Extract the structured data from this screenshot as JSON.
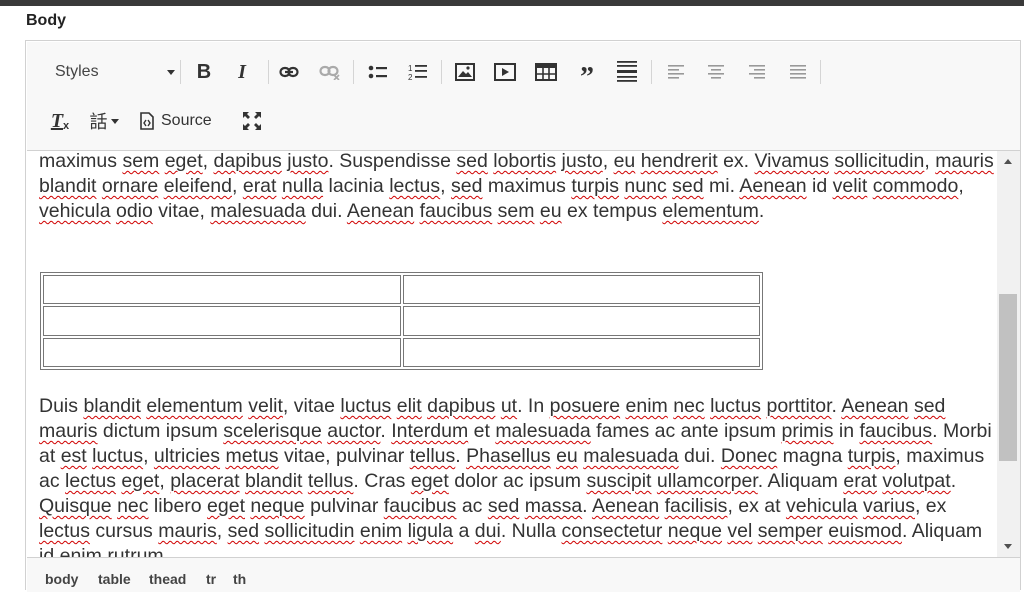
{
  "field": {
    "label": "Body"
  },
  "toolbar": {
    "styles_label": "Styles",
    "bold": "B",
    "italic": "I",
    "remove_format": "T",
    "language": "話",
    "source_label": "Source"
  },
  "content": {
    "para1": [
      {
        "t": "maximus "
      },
      {
        "t": "sem",
        "s": 1
      },
      {
        "t": " "
      },
      {
        "t": "eget",
        "s": 1
      },
      {
        "t": ", "
      },
      {
        "t": "dapibus",
        "s": 1
      },
      {
        "t": " "
      },
      {
        "t": "justo",
        "s": 1
      },
      {
        "t": ". Suspendisse "
      },
      {
        "t": "sed",
        "s": 1
      },
      {
        "t": " "
      },
      {
        "t": "lobortis",
        "s": 1
      },
      {
        "t": " "
      },
      {
        "t": "justo",
        "s": 1
      },
      {
        "t": ", "
      },
      {
        "t": "eu",
        "s": 1
      },
      {
        "t": " "
      },
      {
        "t": "hendrerit",
        "s": 1
      },
      {
        "t": " ex. "
      },
      {
        "t": "Vivamus",
        "s": 1
      },
      {
        "t": " "
      },
      {
        "t": "sollicitudin",
        "s": 1
      },
      {
        "t": ", "
      },
      {
        "t": "mauris",
        "s": 1
      },
      {
        "t": " "
      },
      {
        "t": "blandit",
        "s": 1
      },
      {
        "t": " "
      },
      {
        "t": "ornare",
        "s": 1
      },
      {
        "t": " "
      },
      {
        "t": "eleifend",
        "s": 1
      },
      {
        "t": ", "
      },
      {
        "t": "erat",
        "s": 1
      },
      {
        "t": " "
      },
      {
        "t": "nulla",
        "s": 1
      },
      {
        "t": " lacinia "
      },
      {
        "t": "lectus",
        "s": 1
      },
      {
        "t": ", "
      },
      {
        "t": "sed",
        "s": 1
      },
      {
        "t": " maximus "
      },
      {
        "t": "turpis",
        "s": 1
      },
      {
        "t": " "
      },
      {
        "t": "nunc",
        "s": 1
      },
      {
        "t": " "
      },
      {
        "t": "sed",
        "s": 1
      },
      {
        "t": " "
      },
      {
        "t": "mi. "
      },
      {
        "t": "Aenean",
        "s": 1
      },
      {
        "t": " id "
      },
      {
        "t": "velit",
        "s": 1
      },
      {
        "t": " "
      },
      {
        "t": "commodo",
        "s": 1
      },
      {
        "t": ", "
      },
      {
        "t": "vehicula",
        "s": 1
      },
      {
        "t": " "
      },
      {
        "t": "odio",
        "s": 1
      },
      {
        "t": " vitae, "
      },
      {
        "t": "malesuada",
        "s": 1
      },
      {
        "t": " dui. "
      },
      {
        "t": "Aenean",
        "s": 1
      },
      {
        "t": " "
      },
      {
        "t": "faucibus",
        "s": 1
      },
      {
        "t": " "
      },
      {
        "t": "sem",
        "s": 1
      },
      {
        "t": " "
      },
      {
        "t": "eu",
        "s": 1
      },
      {
        "t": " ex "
      },
      {
        "t": "tempus "
      },
      {
        "t": "elementum",
        "s": 1
      },
      {
        "t": "."
      }
    ],
    "table": {
      "rows": 3,
      "cols": 2
    },
    "para2": [
      {
        "t": "Duis "
      },
      {
        "t": "blandit",
        "s": 1
      },
      {
        "t": " "
      },
      {
        "t": "elementum",
        "s": 1
      },
      {
        "t": " "
      },
      {
        "t": "velit",
        "s": 1
      },
      {
        "t": ", vitae "
      },
      {
        "t": "luctus",
        "s": 1
      },
      {
        "t": " "
      },
      {
        "t": "elit",
        "s": 1
      },
      {
        "t": " "
      },
      {
        "t": "dapibus",
        "s": 1
      },
      {
        "t": " "
      },
      {
        "t": "ut",
        "s": 1
      },
      {
        "t": ". In "
      },
      {
        "t": "posuere",
        "s": 1
      },
      {
        "t": " "
      },
      {
        "t": "enim",
        "s": 1
      },
      {
        "t": " "
      },
      {
        "t": "nec",
        "s": 1
      },
      {
        "t": " "
      },
      {
        "t": "luctus",
        "s": 1
      },
      {
        "t": " "
      },
      {
        "t": "porttitor",
        "s": 1
      },
      {
        "t": ". "
      },
      {
        "t": "Aenean",
        "s": 1
      },
      {
        "t": " "
      },
      {
        "t": "sed",
        "s": 1
      },
      {
        "t": " "
      },
      {
        "t": "mauris",
        "s": 1
      },
      {
        "t": " dictum ipsum "
      },
      {
        "t": "scelerisque",
        "s": 1
      },
      {
        "t": " "
      },
      {
        "t": "auctor",
        "s": 1
      },
      {
        "t": ". "
      },
      {
        "t": "Interdum",
        "s": 1
      },
      {
        "t": " et "
      },
      {
        "t": "malesuada",
        "s": 1
      },
      {
        "t": " fames ac ante ipsum "
      },
      {
        "t": "primis",
        "s": 1
      },
      {
        "t": " in "
      },
      {
        "t": "faucibus",
        "s": 1
      },
      {
        "t": ". Morbi at "
      },
      {
        "t": "est",
        "s": 1
      },
      {
        "t": " "
      },
      {
        "t": "luctus",
        "s": 1
      },
      {
        "t": ", "
      },
      {
        "t": "ultricies",
        "s": 1
      },
      {
        "t": " "
      },
      {
        "t": "metus",
        "s": 1
      },
      {
        "t": " vitae, pulvinar "
      },
      {
        "t": "tellus",
        "s": 1
      },
      {
        "t": ". "
      },
      {
        "t": "Phasellus",
        "s": 1
      },
      {
        "t": " "
      },
      {
        "t": "eu",
        "s": 1
      },
      {
        "t": " "
      },
      {
        "t": "malesuada",
        "s": 1
      },
      {
        "t": " dui. "
      },
      {
        "t": "Donec",
        "s": 1
      },
      {
        "t": " magna "
      },
      {
        "t": "turpis",
        "s": 1
      },
      {
        "t": ", maximus ac "
      },
      {
        "t": "lectus",
        "s": 1
      },
      {
        "t": " "
      },
      {
        "t": "eget",
        "s": 1
      },
      {
        "t": ", "
      },
      {
        "t": "placerat",
        "s": 1
      },
      {
        "t": " "
      },
      {
        "t": "blandit",
        "s": 1
      },
      {
        "t": " "
      },
      {
        "t": "tellus",
        "s": 1
      },
      {
        "t": ". Cras "
      },
      {
        "t": "eget",
        "s": 1
      },
      {
        "t": " "
      },
      {
        "t": "dolor ac ipsum "
      },
      {
        "t": "suscipit",
        "s": 1
      },
      {
        "t": " "
      },
      {
        "t": "ullamcorper",
        "s": 1
      },
      {
        "t": ". Aliquam "
      },
      {
        "t": "erat",
        "s": 1
      },
      {
        "t": " "
      },
      {
        "t": "volutpat",
        "s": 1
      },
      {
        "t": ". "
      },
      {
        "t": "Quisque",
        "s": 1
      },
      {
        "t": " "
      },
      {
        "t": "nec",
        "s": 1
      },
      {
        "t": " libero "
      },
      {
        "t": "eget",
        "s": 1
      },
      {
        "t": " "
      },
      {
        "t": "neque",
        "s": 1
      },
      {
        "t": " pulvinar "
      },
      {
        "t": "faucibus",
        "s": 1
      },
      {
        "t": " ac "
      },
      {
        "t": "sed",
        "s": 1
      },
      {
        "t": " "
      },
      {
        "t": "massa",
        "s": 1
      },
      {
        "t": ". "
      },
      {
        "t": "Aenean",
        "s": 1
      },
      {
        "t": " "
      },
      {
        "t": "facilisis",
        "s": 1
      },
      {
        "t": ", ex at "
      },
      {
        "t": "vehicula",
        "s": 1
      },
      {
        "t": " "
      },
      {
        "t": "varius",
        "s": 1
      },
      {
        "t": ", ex "
      },
      {
        "t": "lectus",
        "s": 1
      },
      {
        "t": " cursus "
      },
      {
        "t": "mauris",
        "s": 1
      },
      {
        "t": ", "
      },
      {
        "t": "sed",
        "s": 1
      },
      {
        "t": " "
      },
      {
        "t": "sollicitudin",
        "s": 1
      },
      {
        "t": " "
      },
      {
        "t": "enim",
        "s": 1
      },
      {
        "t": " "
      },
      {
        "t": "ligula",
        "s": 1
      },
      {
        "t": " a "
      },
      {
        "t": "dui",
        "s": 1
      },
      {
        "t": ". Nulla "
      },
      {
        "t": "consectetur",
        "s": 1
      },
      {
        "t": " "
      },
      {
        "t": "neque",
        "s": 1
      },
      {
        "t": " "
      },
      {
        "t": "vel",
        "s": 1
      },
      {
        "t": " "
      },
      {
        "t": "semper",
        "s": 1
      },
      {
        "t": " "
      },
      {
        "t": "euismod",
        "s": 1
      },
      {
        "t": ". Aliquam id "
      },
      {
        "t": "enim",
        "s": 1
      },
      {
        "t": " "
      },
      {
        "t": "rutrum",
        "s": 1
      }
    ]
  },
  "path": [
    "body",
    "table",
    "thead",
    "tr",
    "th"
  ],
  "colors": {
    "spellcheck": "#d00000",
    "toolbar_bg": "#f8f8f8",
    "border": "#d1d1d1"
  },
  "icons": [
    "bold-icon",
    "italic-icon",
    "link-icon",
    "unlink-icon",
    "bulleted-list-icon",
    "numbered-list-icon",
    "image-icon",
    "media-embed-icon",
    "table-icon",
    "blockquote-icon",
    "horizontal-line-icon",
    "align-left-icon",
    "align-center-icon",
    "align-right-icon",
    "justify-icon",
    "remove-format-icon",
    "language-icon",
    "source-icon",
    "maximize-icon"
  ]
}
